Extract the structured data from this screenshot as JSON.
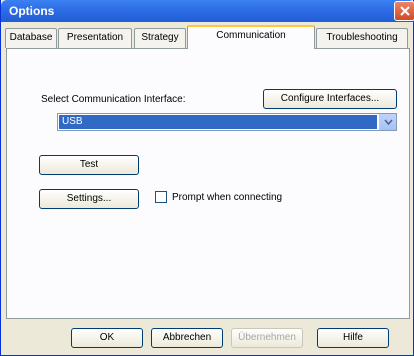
{
  "window": {
    "title": "Options"
  },
  "tabs": [
    {
      "label": "Database"
    },
    {
      "label": "Presentation"
    },
    {
      "label": "Strategy"
    },
    {
      "label": "Communication"
    },
    {
      "label": "Troubleshooting"
    }
  ],
  "communication": {
    "interface_label": "Select Communication Interface:",
    "configure_button": "Configure Interfaces...",
    "interface_value": "USB",
    "test_button": "Test",
    "settings_button": "Settings...",
    "prompt_label": "Prompt when connecting",
    "prompt_checked": false
  },
  "footer": {
    "ok": "OK",
    "cancel": "Abbrechen",
    "apply": "Übernehmen",
    "help": "Hilfe"
  }
}
